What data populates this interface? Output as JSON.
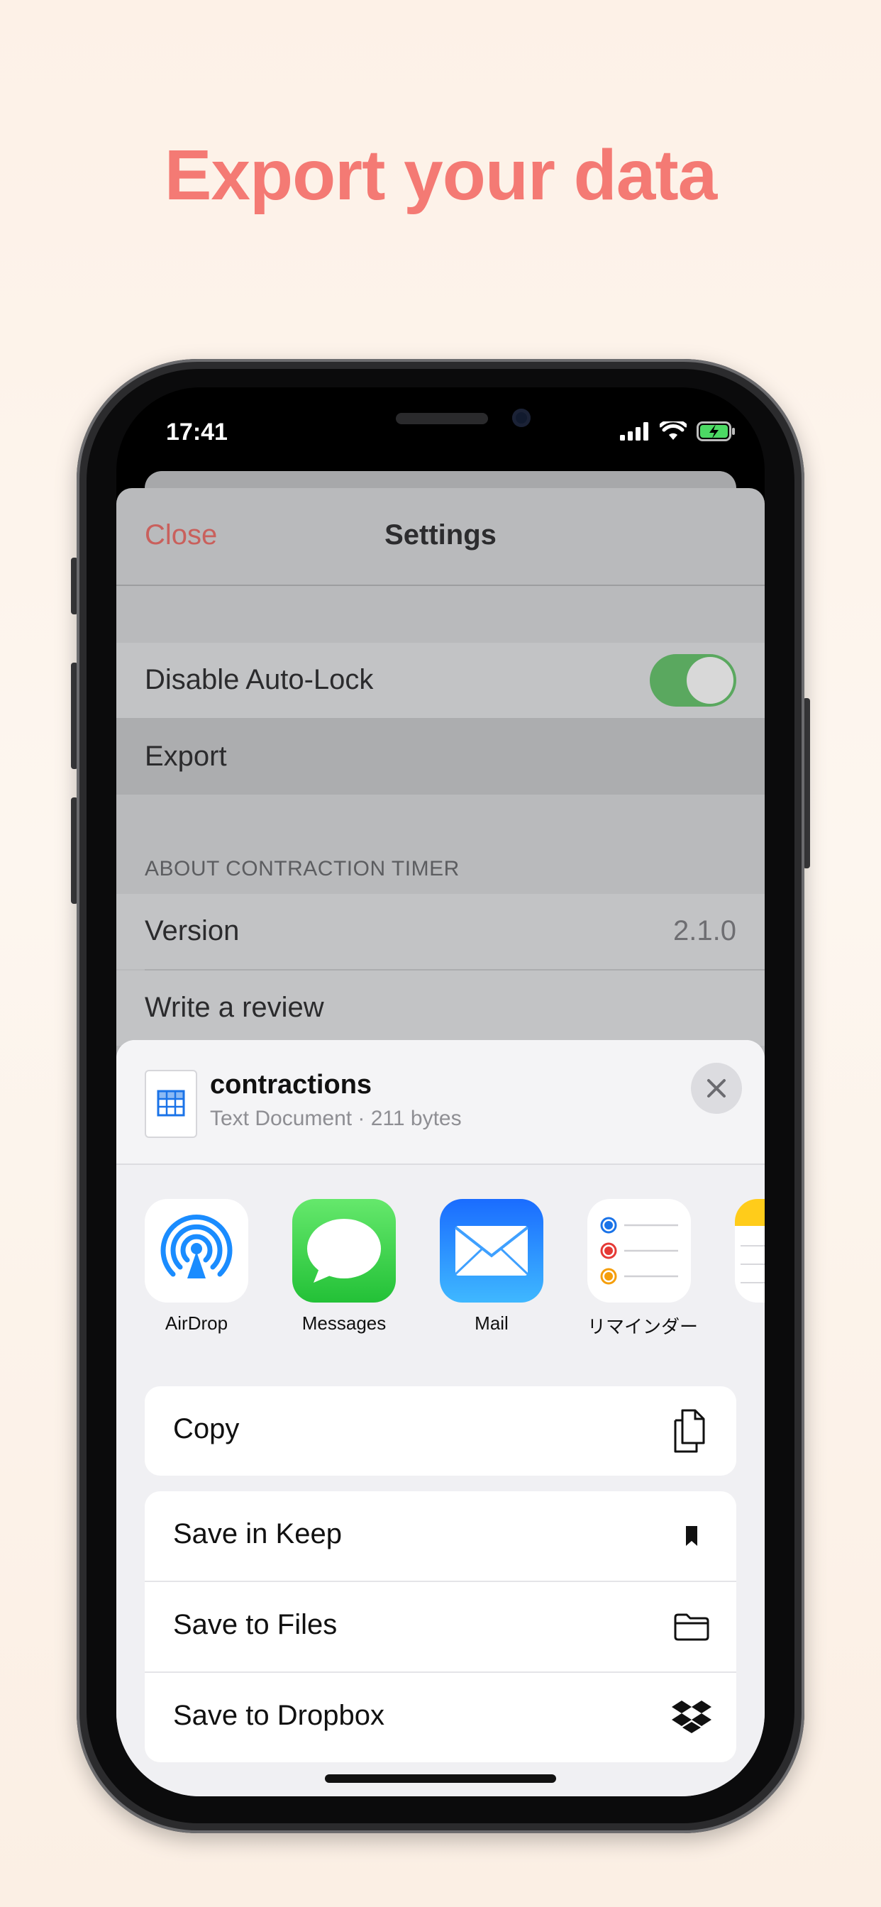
{
  "headline": "Export your data",
  "status_bar": {
    "time": "17:41"
  },
  "settings": {
    "close_label": "Close",
    "title": "Settings",
    "rows": {
      "disable_auto_lock": {
        "label": "Disable Auto-Lock",
        "enabled": true
      },
      "export": {
        "label": "Export"
      }
    },
    "about_header": "ABOUT CONTRACTION TIMER",
    "version": {
      "label": "Version",
      "value": "2.1.0"
    },
    "review": {
      "label": "Write a review"
    }
  },
  "share_sheet": {
    "file_name": "contractions",
    "file_info": "Text Document · 211 bytes",
    "apps": [
      {
        "label": "AirDrop",
        "icon": "airdrop-icon"
      },
      {
        "label": "Messages",
        "icon": "messages-icon"
      },
      {
        "label": "Mail",
        "icon": "mail-icon"
      },
      {
        "label": "リマインダー",
        "icon": "reminders-icon"
      }
    ],
    "actions": {
      "copy": {
        "label": "Copy",
        "icon": "copy-icon"
      },
      "save_keep": {
        "label": "Save in Keep",
        "icon": "bookmark-icon"
      },
      "save_files": {
        "label": "Save to Files",
        "icon": "folder-icon"
      },
      "save_dropbox": {
        "label": "Save to Dropbox",
        "icon": "dropbox-icon"
      }
    }
  },
  "colors": {
    "headline": "#f47a74",
    "close": "#c9605c",
    "toggle_on": "#5aa85f",
    "messages_green": "#34c759",
    "mail_blue": "#1e8bff",
    "airdrop_blue": "#1a8cff"
  }
}
